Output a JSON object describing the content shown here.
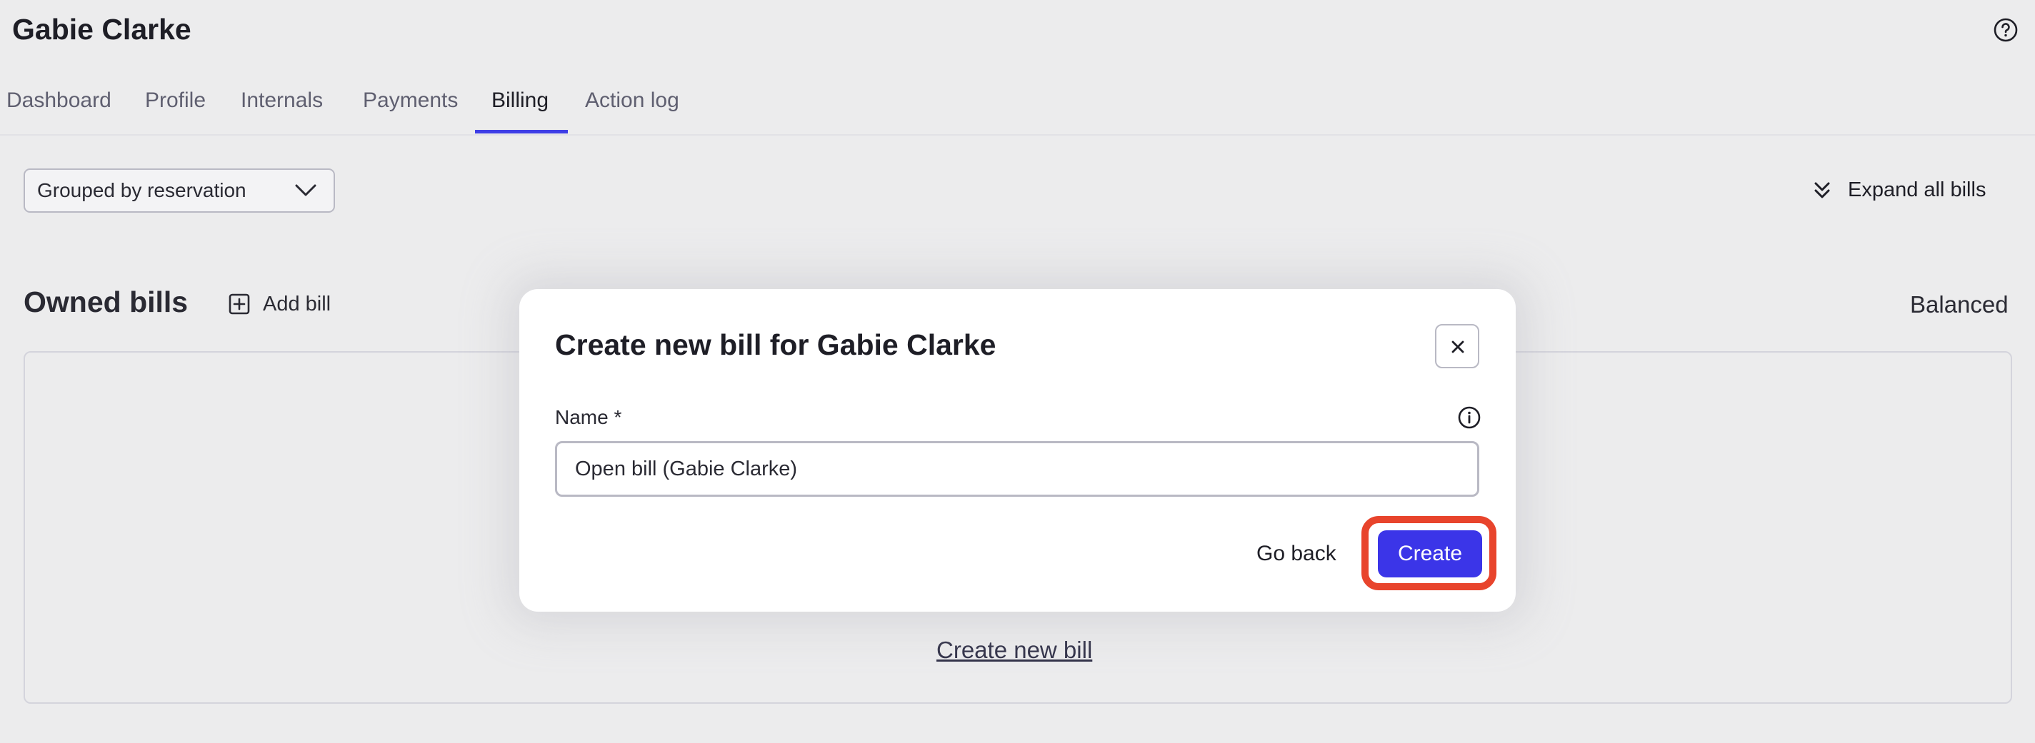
{
  "header": {
    "title": "Gabie Clarke",
    "help_icon": "help-circle-icon"
  },
  "tabs": [
    {
      "label": "Dashboard"
    },
    {
      "label": "Profile"
    },
    {
      "label": "Internals"
    },
    {
      "label": "Payments"
    },
    {
      "label": "Billing",
      "active": true
    },
    {
      "label": "Action log"
    }
  ],
  "toolbar": {
    "grouping_value": "Grouped by reservation",
    "expand_label": "Expand all bills"
  },
  "bills": {
    "heading": "Owned bills",
    "add_label": "Add bill",
    "status": "Balanced",
    "create_link": "Create new bill"
  },
  "modal": {
    "title": "Create new bill for Gabie Clarke",
    "name_label": "Name *",
    "name_value": "Open bill (Gabie Clarke)",
    "go_back_label": "Go back",
    "create_label": "Create"
  },
  "colors": {
    "accent": "#3b35e8",
    "highlight": "#e8442c",
    "background": "#ececed"
  }
}
